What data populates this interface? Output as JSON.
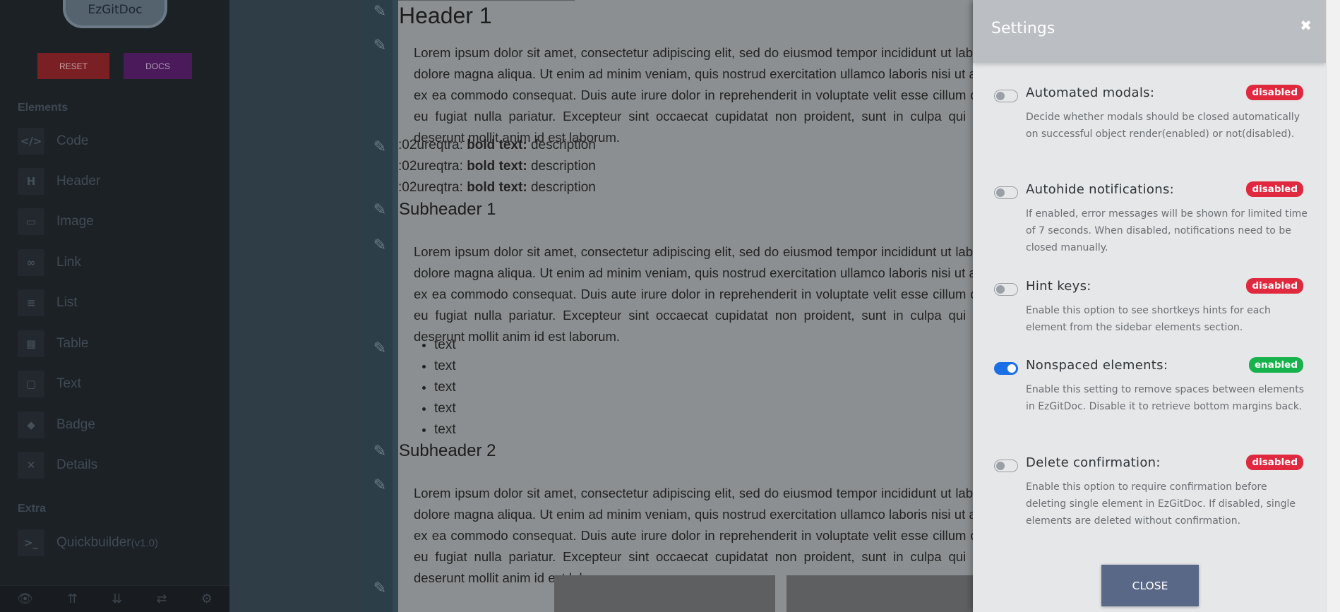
{
  "sidebar": {
    "logo": "EzGitDoc",
    "reset_label": "RESET",
    "docs_label": "DOCS",
    "elements_heading": "Elements",
    "items": [
      {
        "icon": "code-icon",
        "glyph": "</>",
        "label": "Code"
      },
      {
        "icon": "header-icon",
        "glyph": "H",
        "label": "Header"
      },
      {
        "icon": "image-icon",
        "glyph": "▭",
        "label": "Image"
      },
      {
        "icon": "link-icon",
        "glyph": "∞",
        "label": "Link"
      },
      {
        "icon": "list-icon",
        "glyph": "≡",
        "label": "List"
      },
      {
        "icon": "table-icon",
        "glyph": "▦",
        "label": "Table"
      },
      {
        "icon": "text-icon",
        "glyph": "▢",
        "label": "Text"
      },
      {
        "icon": "badge-icon",
        "glyph": "◆",
        "label": "Badge"
      },
      {
        "icon": "details-icon",
        "glyph": "✕",
        "label": "Details"
      }
    ],
    "extra_heading": "Extra",
    "extra_items": [
      {
        "icon": "terminal-icon",
        "glyph": ">_",
        "label": "Quickbuilder",
        "suffix": "(v1.0)"
      }
    ],
    "bottom_icons": [
      {
        "name": "preview-eye-icon",
        "glyph": "👁"
      },
      {
        "name": "collapse-all-icon",
        "glyph": "⇈"
      },
      {
        "name": "expand-all-icon",
        "glyph": "⇊"
      },
      {
        "name": "swap-icon",
        "glyph": "⇄"
      },
      {
        "name": "settings-gear-icon",
        "glyph": "⚙"
      }
    ]
  },
  "doc": {
    "header1": "Header 1",
    "paragraph": "Lorem ipsum dolor sit amet, consectetur adipiscing elit, sed do eiusmod tempor incididunt ut labore et dolore magna aliqua. Ut enim ad minim veniam, quis nostrud exercitation ullamco laboris nisi ut aliquip ex ea commodo consequat. Duis aute irure dolor in reprehenderit in voluptate velit esse cillum dolore eu fugiat nulla pariatur. Excepteur sint occaecat cupidatat non proident, sunt in culpa qui officia deserunt mollit anim id est laborum.",
    "kv_prefix": ":02ureqtra:",
    "kv_bold": "bold text:",
    "kv_desc": "description",
    "subheader1": "Subheader 1",
    "subheader2": "Subheader 2",
    "list_items": [
      "text",
      "text",
      "text",
      "text",
      "text"
    ]
  },
  "settings": {
    "title": "Settings",
    "close_x": "✖",
    "items": [
      {
        "name": "Automated modals:",
        "status": "disabled",
        "enabled": false,
        "desc": "Decide whether modals should be closed automatically on successful object render(enabled) or not(disabled)."
      },
      {
        "name": "Autohide notifications:",
        "status": "disabled",
        "enabled": false,
        "desc": "If enabled, error messages will be shown for limited time of 7 seconds. When disabled, notifications need to be closed manually."
      },
      {
        "name": "Hint keys:",
        "status": "disabled",
        "enabled": false,
        "desc": "Enable this option to see shortkeys hints for each element from the sidebar elements section."
      },
      {
        "name": "Nonspaced elements:",
        "status": "enabled",
        "enabled": true,
        "desc": "Enable this setting to remove spaces between elements in EzGitDoc. Disable it to retrieve bottom margins back."
      },
      {
        "name": "Delete confirmation:",
        "status": "disabled",
        "enabled": false,
        "desc": "Enable this option to require confirmation before deleting single element in EzGitDoc. If disabled, single elements are deleted without confirmation."
      }
    ],
    "close_label": "CLOSE"
  }
}
